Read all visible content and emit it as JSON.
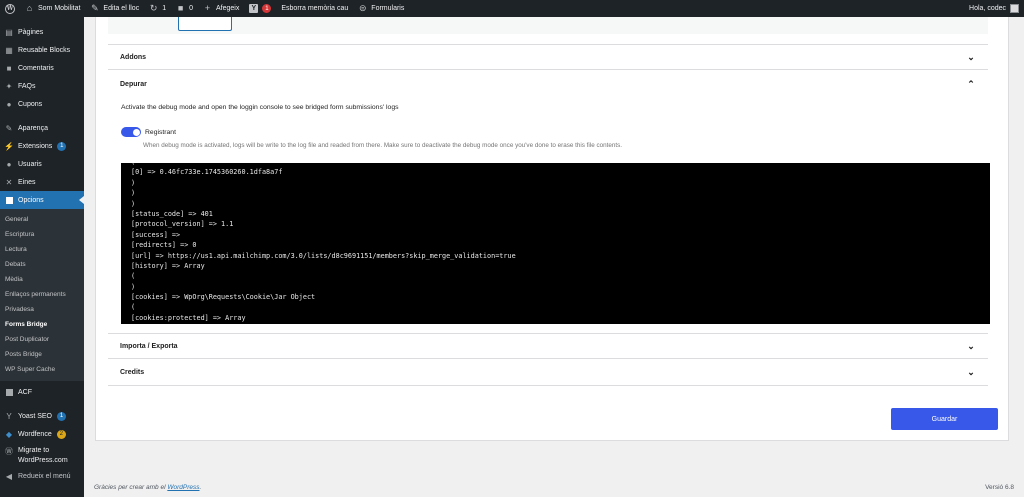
{
  "adminbar": {
    "site_name": "Som Mobilitat",
    "edit_site": "Edita el lloc",
    "updates_count": "1",
    "comments_count": "0",
    "new_label": "Afegeix",
    "yoast_count": "1",
    "flush_cache": "Esborra memòria cau",
    "forms_label": "Formularis",
    "greeting": "Hola, codec"
  },
  "sidebar": {
    "items_top": [
      {
        "label": "Pàgines",
        "icon": "pages-icon"
      },
      {
        "label": "Reusable Blocks",
        "icon": "blocks-icon"
      },
      {
        "label": "Comentaris",
        "icon": "comments-icon"
      },
      {
        "label": "FAQs",
        "icon": "pin-icon"
      },
      {
        "label": "Cupons",
        "icon": "user-icon"
      }
    ],
    "items_mid": [
      {
        "label": "Aparença",
        "icon": "brush-icon"
      },
      {
        "label": "Extensions",
        "icon": "plugin-icon",
        "badge": "1"
      },
      {
        "label": "Usuaris",
        "icon": "user-icon"
      },
      {
        "label": "Eines",
        "icon": "wrench-icon"
      },
      {
        "label": "Opcions",
        "icon": "settings-icon"
      }
    ],
    "submenu": [
      "General",
      "Escriptura",
      "Lectura",
      "Debats",
      "Mèdia",
      "Enllaços permanents",
      "Privadesa",
      "Forms Bridge",
      "Post Duplicator",
      "Posts Bridge",
      "WP Super Cache"
    ],
    "items_bottom": [
      {
        "label": "ACF",
        "icon": "acf-icon"
      },
      {
        "label": "Yoast SEO",
        "icon": "yoast-icon",
        "badge": "1"
      },
      {
        "label": "Wordfence",
        "icon": "wordfence-icon",
        "badge": "2"
      },
      {
        "label": "Migrate to WordPress.com",
        "icon": "wordpress-icon"
      },
      {
        "label": "Redueix el menú",
        "icon": "collapse-icon"
      }
    ]
  },
  "panel": {
    "addons_title": "Addons",
    "debug_title": "Depurar",
    "debug_description": "Activate the debug mode and open the loggin console to see bridged form submissions' logs",
    "toggle_label": "Registrant",
    "toggle_on": true,
    "toggle_help": "When debug mode is activated, logs will be write to the log file and readed from there. Make sure to deactivate the debug mode once you've done to erase this file contents.",
    "console_lines": [
      "(",
      "[0] => 0.46fc733e.1745360260.1dfa8a7f",
      ")",
      ")",
      ")",
      "[status_code] => 401",
      "[protocol_version] => 1.1",
      "[success] =>",
      "[redirects] => 0",
      "[url] => https://us1.api.mailchimp.com/3.0/lists/d8c9691151/members?skip_merge_validation=true",
      "[history] => Array",
      "(",
      ")",
      "[cookies] => WpOrg\\Requests\\Cookie\\Jar Object",
      "(",
      "[cookies:protected] => Array"
    ],
    "import_export_title": "Importa / Exporta",
    "credits_title": "Credits",
    "save_label": "Guardar"
  },
  "footer": {
    "thanks_prefix": "Gràcies per crear amb el ",
    "wordpress_link": "WordPress",
    "thanks_suffix": ".",
    "version": "Versió 6.8"
  },
  "colors": {
    "admin_dark": "#1d2327",
    "admin_blue": "#2271b1",
    "accent": "#3858e9"
  }
}
